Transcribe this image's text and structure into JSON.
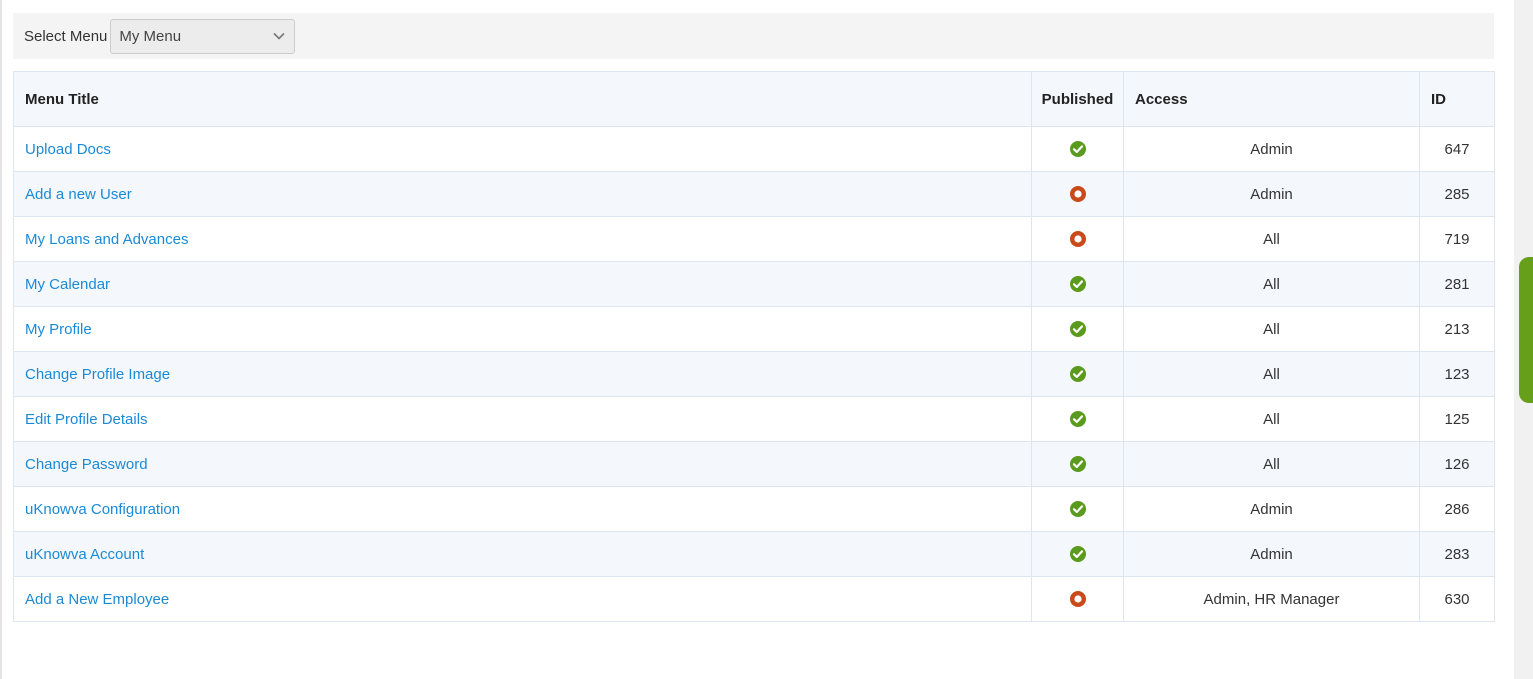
{
  "toolbar": {
    "select_label": "Select Menu",
    "select_value": "My Menu"
  },
  "table": {
    "headers": {
      "title": "Menu Title",
      "published": "Published",
      "access": "Access",
      "id": "ID"
    },
    "rows": [
      {
        "title": "Upload Docs",
        "published": true,
        "access": "Admin",
        "id": "647"
      },
      {
        "title": "Add a new User",
        "published": false,
        "access": "Admin",
        "id": "285"
      },
      {
        "title": "My Loans and Advances",
        "published": false,
        "access": "All",
        "id": "719"
      },
      {
        "title": "My Calendar",
        "published": true,
        "access": "All",
        "id": "281"
      },
      {
        "title": "My Profile",
        "published": true,
        "access": "All",
        "id": "213"
      },
      {
        "title": "Change Profile Image",
        "published": true,
        "access": "All",
        "id": "123"
      },
      {
        "title": "Edit Profile Details",
        "published": true,
        "access": "All",
        "id": "125"
      },
      {
        "title": "Change Password",
        "published": true,
        "access": "All",
        "id": "126"
      },
      {
        "title": "uKnowva Configuration",
        "published": true,
        "access": "Admin",
        "id": "286"
      },
      {
        "title": "uKnowva Account",
        "published": true,
        "access": "Admin",
        "id": "283"
      },
      {
        "title": "Add a New Employee",
        "published": false,
        "access": "Admin, HR Manager",
        "id": "630"
      }
    ]
  },
  "icons": {
    "published": "published-check-icon",
    "unpublished": "unpublished-circle-icon",
    "dropdown": "chevron-down-icon"
  },
  "colors": {
    "link": "#1b8ad6",
    "published_green": "#5a9a1c",
    "unpublished_red": "#c94a1a",
    "side_tab": "#66a01a"
  }
}
